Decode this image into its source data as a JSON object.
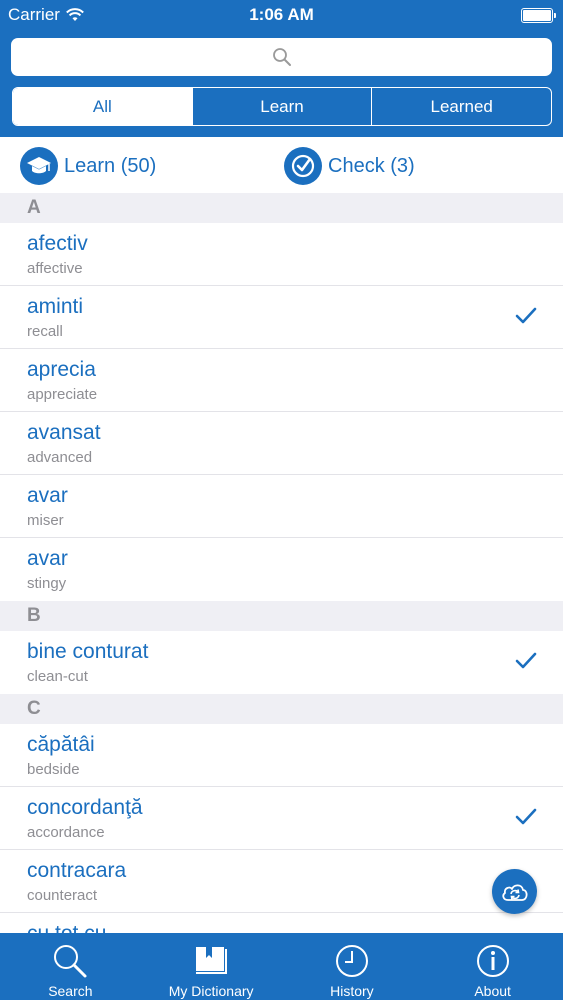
{
  "status_bar": {
    "carrier": "Carrier",
    "time": "1:06 AM"
  },
  "search": {
    "placeholder": ""
  },
  "segments": [
    {
      "label": "All",
      "active": true
    },
    {
      "label": "Learn",
      "active": false
    },
    {
      "label": "Learned",
      "active": false
    }
  ],
  "actions": {
    "learn_label": "Learn (50)",
    "check_label": "Check (3)"
  },
  "sections": [
    {
      "letter": "A",
      "rows": [
        {
          "word": "afectiv",
          "translation": "affective",
          "checked": false
        },
        {
          "word": "aminti",
          "translation": "recall",
          "checked": true
        },
        {
          "word": "aprecia",
          "translation": "appreciate",
          "checked": false
        },
        {
          "word": "avansat",
          "translation": "advanced",
          "checked": false
        },
        {
          "word": "avar",
          "translation": "miser",
          "checked": false
        },
        {
          "word": "avar",
          "translation": "stingy",
          "checked": false
        }
      ]
    },
    {
      "letter": "B",
      "rows": [
        {
          "word": "bine conturat",
          "translation": "clean-cut",
          "checked": true
        }
      ]
    },
    {
      "letter": "C",
      "rows": [
        {
          "word": "căpătâi",
          "translation": "bedside",
          "checked": false
        },
        {
          "word": "concordanţă",
          "translation": "accordance",
          "checked": true
        },
        {
          "word": "contracara",
          "translation": "counteract",
          "checked": false
        },
        {
          "word": "cu tot cu",
          "translation": "",
          "checked": false
        }
      ]
    }
  ],
  "tabbar": [
    {
      "label": "Search",
      "icon": "search-icon"
    },
    {
      "label": "My Dictionary",
      "icon": "book-icon"
    },
    {
      "label": "History",
      "icon": "clock-icon"
    },
    {
      "label": "About",
      "icon": "info-icon"
    }
  ],
  "colors": {
    "accent": "#1b6fbf",
    "section_bg": "#efeff4",
    "secondary_text": "#8e8e93"
  }
}
